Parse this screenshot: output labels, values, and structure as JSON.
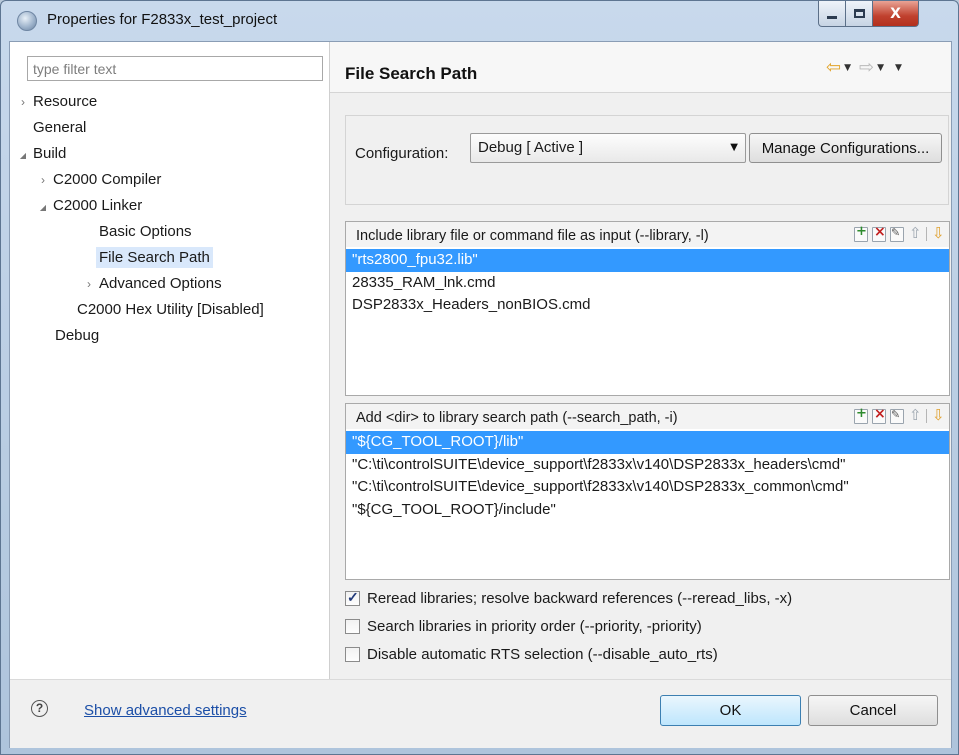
{
  "window": {
    "title": "Properties for F2833x_test_project",
    "controls": {
      "minimize": "–",
      "maximize": "□",
      "close": "X"
    }
  },
  "sidebar": {
    "filter_placeholder": "type filter text",
    "items": [
      {
        "label": "Resource",
        "twisty": "›"
      },
      {
        "label": "General",
        "twisty": ""
      },
      {
        "label": "Build",
        "twisty": "◢"
      },
      {
        "label": "C2000 Compiler",
        "twisty": "›"
      },
      {
        "label": "C2000 Linker",
        "twisty": "◢"
      },
      {
        "label": "Basic Options",
        "twisty": ""
      },
      {
        "label": "File Search Path",
        "twisty": ""
      },
      {
        "label": "Advanced Options",
        "twisty": "›"
      },
      {
        "label": "C2000 Hex Utility  [Disabled]",
        "twisty": ""
      },
      {
        "label": "Debug",
        "twisty": ""
      }
    ],
    "selected_index": 6
  },
  "main": {
    "title": "File Search Path",
    "nav": {
      "back_icon": "back-arrow-icon",
      "forward_icon": "forward-arrow-icon"
    },
    "configuration": {
      "label": "Configuration:",
      "selected": "Debug  [ Active ]",
      "manage_button": "Manage Configurations..."
    },
    "library_list": {
      "title": "Include library file or command file as input (--library, -l)",
      "rows": [
        "\"rts2800_fpu32.lib\"",
        "28335_RAM_lnk.cmd",
        "DSP2833x_Headers_nonBIOS.cmd"
      ],
      "selected_index": 0
    },
    "search_path_list": {
      "title": "Add <dir> to library search path (--search_path, -i)",
      "rows": [
        "\"${CG_TOOL_ROOT}/lib\"",
        "\"C:\\ti\\controlSUITE\\device_support\\f2833x\\v140\\DSP2833x_headers\\cmd\"",
        "\"C:\\ti\\controlSUITE\\device_support\\f2833x\\v140\\DSP2833x_common\\cmd\"",
        "\"${CG_TOOL_ROOT}/include\""
      ],
      "selected_index": 0
    },
    "options": [
      {
        "label": "Reread libraries; resolve backward references (--reread_libs, -x)",
        "checked": true
      },
      {
        "label": "Search libraries in priority order (--priority, -priority)",
        "checked": false
      },
      {
        "label": "Disable automatic RTS selection (--disable_auto_rts)",
        "checked": false
      }
    ]
  },
  "footer": {
    "help_glyph": "?",
    "advanced_link": "Show advanced settings",
    "ok_label": "OK",
    "cancel_label": "Cancel"
  },
  "colors": {
    "selection": "#3399ff",
    "link": "#1c4fa7",
    "close_button": "#c0412e"
  }
}
